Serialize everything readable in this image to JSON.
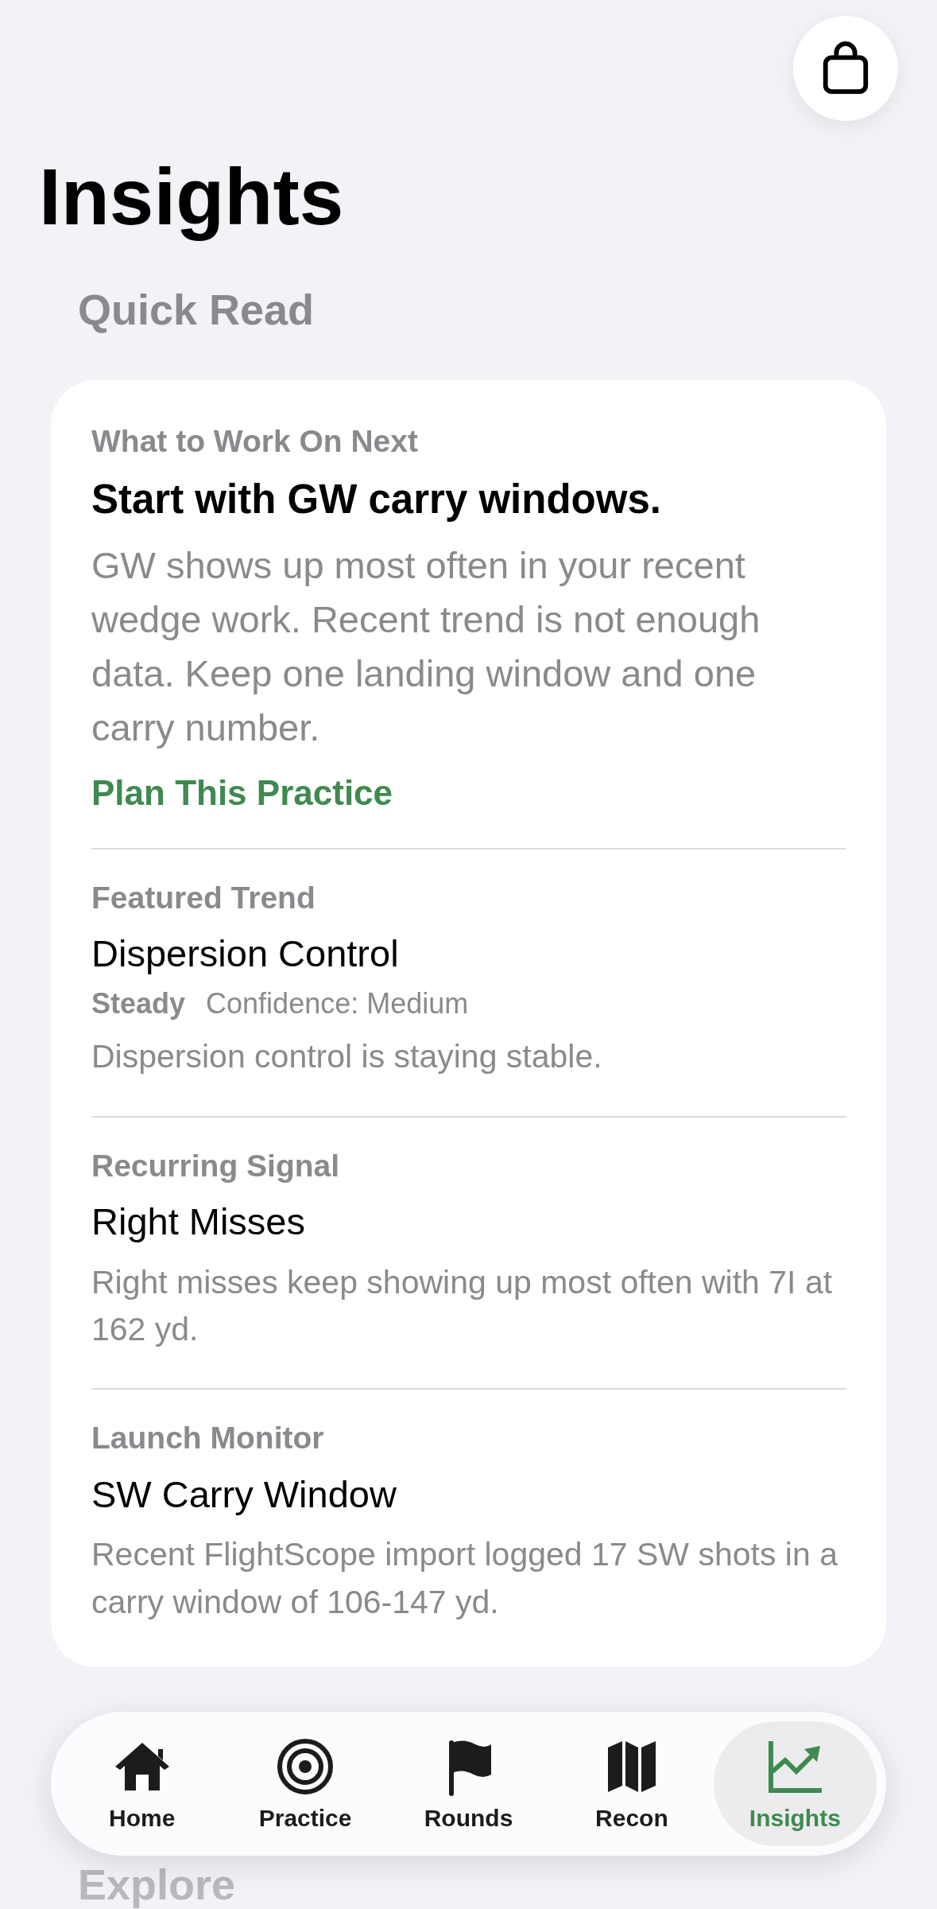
{
  "title": "Insights",
  "section_heading": "Quick Read",
  "cards": [
    {
      "eyebrow": "What to Work On Next",
      "headline": "Start with GW carry windows.",
      "body": "GW shows up most often in your recent wedge work. Recent trend is not enough data. Keep one landing window and one carry number.",
      "link": "Plan This Practice"
    },
    {
      "eyebrow": "Featured Trend",
      "headline": "Dispersion Control",
      "status": "Steady",
      "confidence": "Confidence: Medium",
      "body": "Dispersion control is staying stable."
    },
    {
      "eyebrow": "Recurring Signal",
      "headline": "Right Misses",
      "body": "Right misses keep showing up most often with 7I at 162 yd."
    },
    {
      "eyebrow": "Launch Monitor",
      "headline": "SW Carry Window",
      "body": "Recent FlightScope import logged 17 SW shots in a carry window of 106-147 yd."
    }
  ],
  "next_heading": "Explore",
  "tabs": [
    {
      "label": "Home",
      "selected": false
    },
    {
      "label": "Practice",
      "selected": false
    },
    {
      "label": "Rounds",
      "selected": false
    },
    {
      "label": "Recon",
      "selected": false
    },
    {
      "label": "Insights",
      "selected": true
    }
  ]
}
